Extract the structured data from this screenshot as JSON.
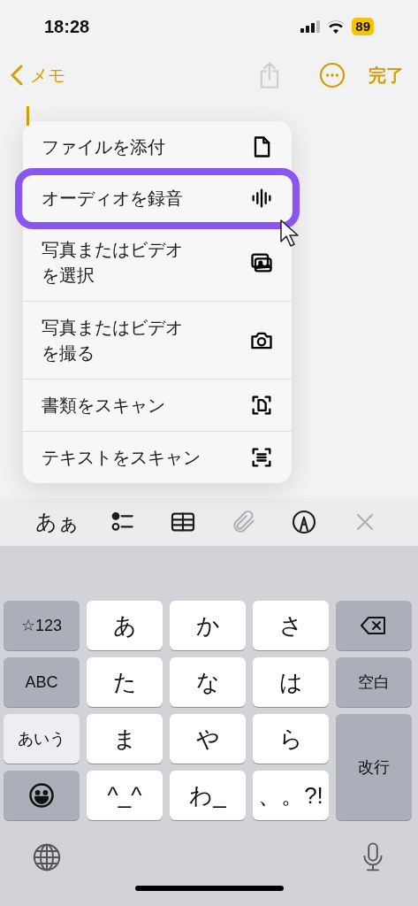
{
  "status_bar": {
    "time": "18:28",
    "battery": "89"
  },
  "nav": {
    "back_label": "メモ",
    "done_label": "完了",
    "share_disabled": true
  },
  "menu": [
    {
      "label": "ファイルを添付",
      "kind": "file",
      "highlighted": false
    },
    {
      "label": "オーディオを録音",
      "kind": "waveform",
      "highlighted": true
    },
    {
      "label": "写真またはビデオを選択",
      "kind": "photos",
      "highlighted": false
    },
    {
      "label": "写真またはビデオを撮る",
      "kind": "camera",
      "highlighted": false
    },
    {
      "label": "書類をスキャン",
      "kind": "scan-document",
      "highlighted": false
    },
    {
      "label": "テキストをスキャン",
      "kind": "scan-text",
      "highlighted": false
    }
  ],
  "toolbar": [
    {
      "kind": "format",
      "label": "あぁ",
      "disabled": false
    },
    {
      "kind": "checklist",
      "disabled": false
    },
    {
      "kind": "table",
      "disabled": false
    },
    {
      "kind": "attach",
      "disabled": true
    },
    {
      "kind": "markup",
      "disabled": false
    },
    {
      "kind": "close",
      "disabled": true
    }
  ],
  "keys": [
    {
      "kind": "mode",
      "label": "☆123",
      "selected": false
    },
    {
      "kind": "letter",
      "label": "あ"
    },
    {
      "kind": "letter",
      "label": "か"
    },
    {
      "kind": "letter",
      "label": "さ"
    },
    {
      "kind": "delete"
    },
    {
      "kind": "mode",
      "label": "ABC",
      "selected": false
    },
    {
      "kind": "letter",
      "label": "た"
    },
    {
      "kind": "letter",
      "label": "な"
    },
    {
      "kind": "letter",
      "label": "は"
    },
    {
      "kind": "function",
      "label": "空白"
    },
    {
      "kind": "mode",
      "label": "あいう",
      "selected": true
    },
    {
      "kind": "letter",
      "label": "ま"
    },
    {
      "kind": "letter",
      "label": "や"
    },
    {
      "kind": "letter",
      "label": "ら"
    },
    {
      "kind": "return",
      "label": "改行"
    },
    {
      "kind": "emoji"
    },
    {
      "kind": "letter",
      "label": "^_^"
    },
    {
      "kind": "letter",
      "label": "わ_"
    },
    {
      "kind": "letter",
      "label": "、。?!"
    }
  ]
}
